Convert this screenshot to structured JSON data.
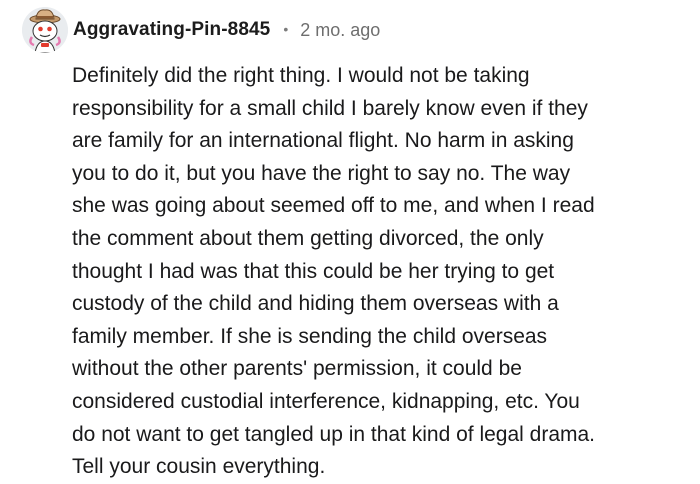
{
  "comment": {
    "author": "Aggravating-Pin-8845",
    "separator": "•",
    "timestamp": "2 mo. ago",
    "avatar_icon": "snoo-avatar-icon",
    "lines": [
      "Definitely did the right thing. I would not be taking",
      "responsibility for a small child I barely know even if they",
      "are family for an international flight. No harm in asking",
      "you to do it, but you have the right to say no. The way",
      "she was going about seemed off to me, and when I read",
      "the comment about them getting divorced, the only",
      "thought I had was that this could be her trying to get",
      "custody of the child and hiding them overseas with a",
      "family member. If she is sending the child overseas",
      "without the other parents' permission, it could be",
      "considered custodial interference, kidnapping, etc. You",
      "do not want to get tangled up in that kind of legal drama.",
      "Tell your cousin everything."
    ]
  }
}
